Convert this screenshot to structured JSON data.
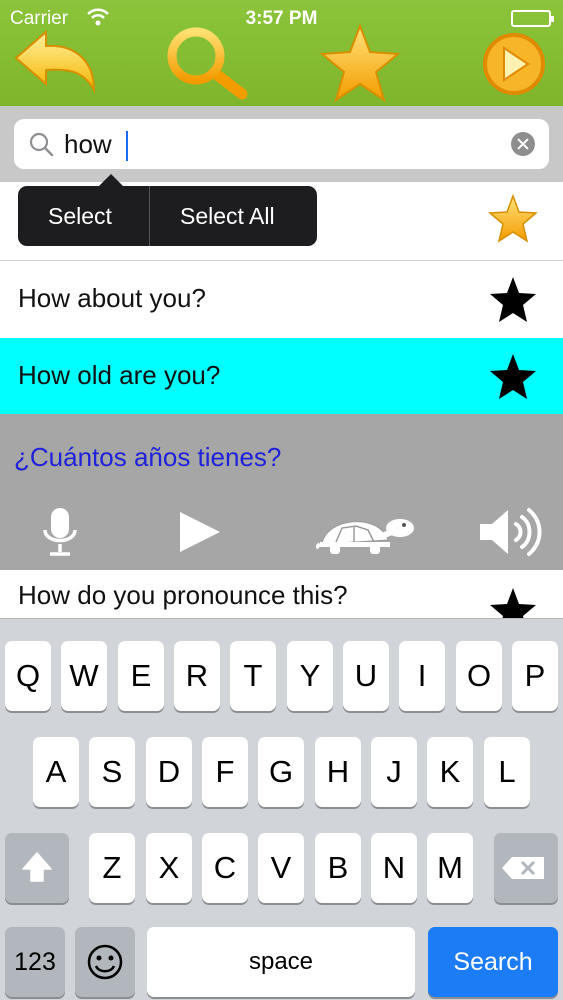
{
  "status_bar": {
    "carrier": "Carrier",
    "time": "3:57 PM"
  },
  "toolbar": {
    "back": "back-arrow-icon",
    "search": "magnifier-icon",
    "favorites": "star-icon",
    "play": "play-circle-icon"
  },
  "search": {
    "value": "how",
    "placeholder": ""
  },
  "edit_menu": {
    "select": "Select",
    "select_all": "Select All"
  },
  "list": {
    "rows": [
      {
        "label": "",
        "starred": true
      },
      {
        "label": "How about you?",
        "starred": false
      },
      {
        "label": "How old are you?",
        "starred": false,
        "selected": true
      },
      {
        "label": "How do you pronounce this?",
        "starred": false
      }
    ],
    "detail": {
      "translation": "¿Cuántos años tienes?",
      "controls": [
        "microphone-icon",
        "play-icon",
        "turtle-icon",
        "speaker-icon"
      ]
    }
  },
  "keyboard": {
    "row1": [
      "Q",
      "W",
      "E",
      "R",
      "T",
      "Y",
      "U",
      "I",
      "O",
      "P"
    ],
    "row2": [
      "A",
      "S",
      "D",
      "F",
      "G",
      "H",
      "J",
      "K",
      "L"
    ],
    "row3": [
      "Z",
      "X",
      "C",
      "V",
      "B",
      "N",
      "M"
    ],
    "numbers": "123",
    "space": "space",
    "search": "Search"
  },
  "colors": {
    "toolbar_green": "#8bc43a",
    "selected_row": "#00ffff",
    "detail_bg": "#a6a6a6",
    "translation_text": "#1f22d8",
    "search_key": "#1b7cf5"
  }
}
